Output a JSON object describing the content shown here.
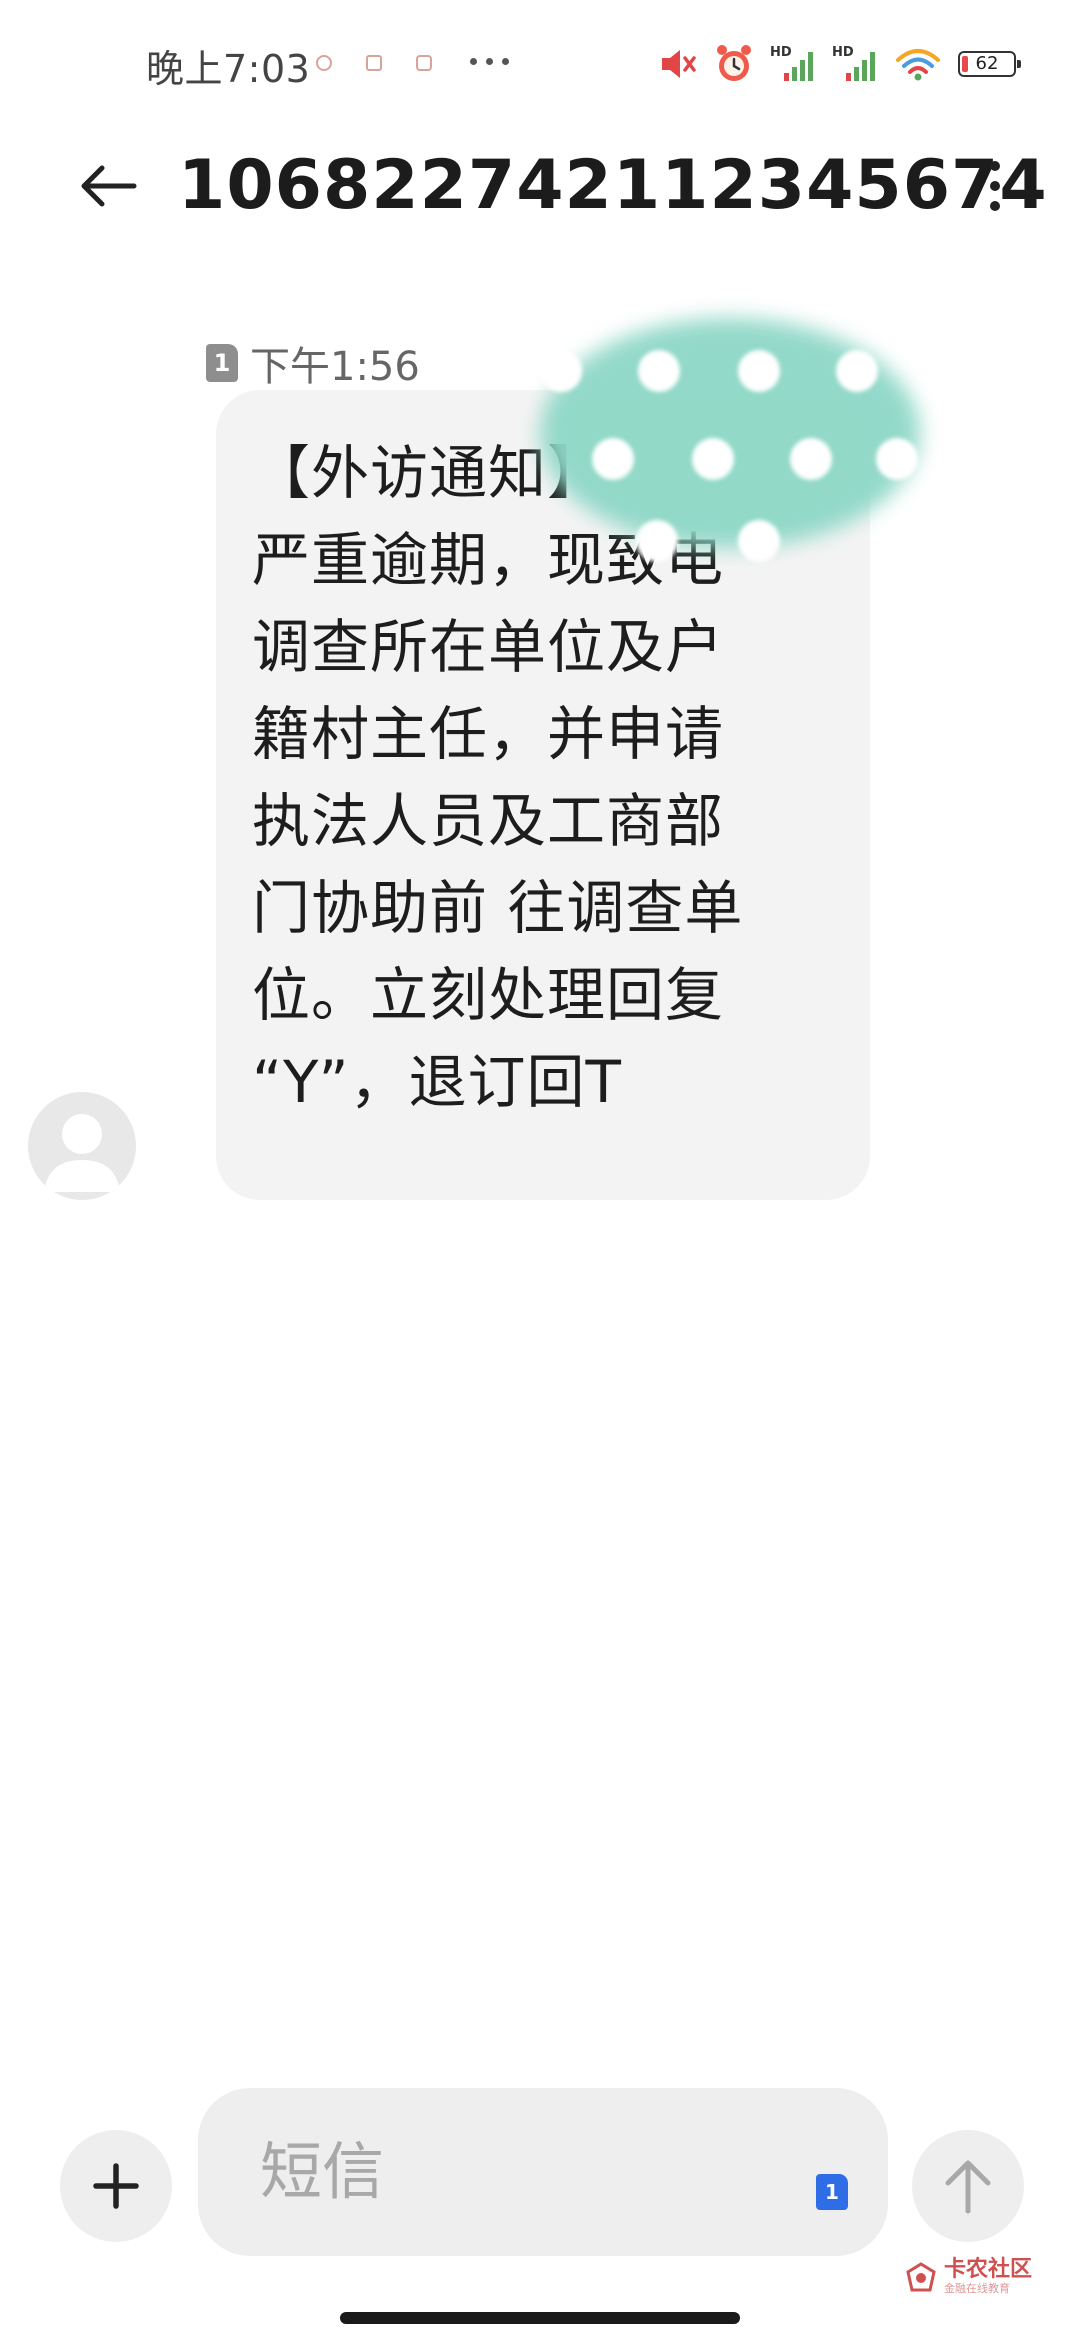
{
  "status_bar": {
    "time": "晚上7:03",
    "battery_level": "62",
    "icons": [
      "mute-icon",
      "alarm-icon",
      "hd-signal-icon",
      "hd-signal-icon",
      "wifi-icon",
      "battery-icon"
    ]
  },
  "header": {
    "title": "10682274211234567​4"
  },
  "message": {
    "sim_slot": "1",
    "time": "下午1:56",
    "text": "【外访通知】",
    "text_lines": [
      "严重逾期，现致电",
      "调查所在单位及户",
      "籍村主任，并申请",
      "执法人员及工商部",
      "门协助前 往调查单",
      "位。立刻处理回复",
      "“Y”，退订回T"
    ]
  },
  "composer": {
    "placeholder": "短信",
    "sim_slot": "1"
  },
  "watermark": {
    "title": "卡农社区",
    "subtitle": "金融在线教育"
  },
  "colors": {
    "bubble": "#f3f3f3",
    "redaction": "#8fd8c7",
    "sim_badge": "#2e6de6"
  }
}
